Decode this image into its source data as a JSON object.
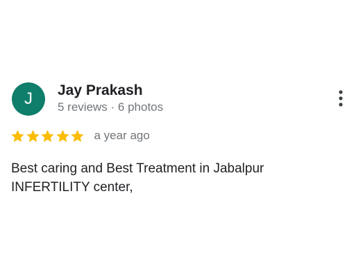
{
  "review": {
    "author": {
      "initial": "J",
      "name": "Jay Prakash",
      "meta": "5 reviews · 6 photos",
      "avatar_color": "#0f7e6a"
    },
    "menu_icon": "more-vertical-icon",
    "rating": {
      "stars": 5,
      "max": 5,
      "star_color": "#fbbc04",
      "icon": "star-icon"
    },
    "time_ago": "a year ago",
    "text_lines": [
      "Best caring and Best Treatment in Jabalpur",
      "INFERTILITY center,"
    ]
  }
}
